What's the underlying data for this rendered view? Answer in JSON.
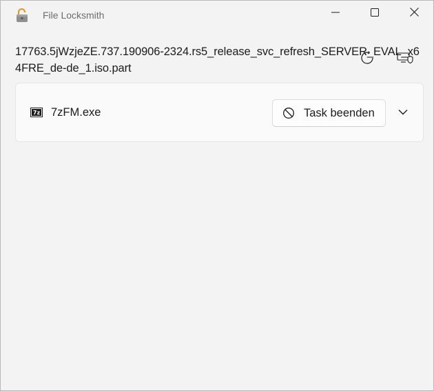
{
  "window": {
    "title": "File Locksmith",
    "controls": [
      "minimize",
      "maximize",
      "close"
    ]
  },
  "file": {
    "path": "17763.5jWzjeZE.737.190906-2324.rs5_release_svc_refresh_SERVER_EVAL_x64FRE_de-de_1.iso.part"
  },
  "toolbar": {
    "refresh_icon": "refresh-icon",
    "admin_icon": "admin-restart-icon"
  },
  "processes": [
    {
      "name": "7zFM.exe",
      "icon": "7zip-icon",
      "end_task_label": "Task beenden"
    }
  ],
  "colors": {
    "background": "#f3f3f3",
    "card": "#fafafa",
    "text": "#1b1b1b",
    "muted": "#6d6d6d"
  }
}
